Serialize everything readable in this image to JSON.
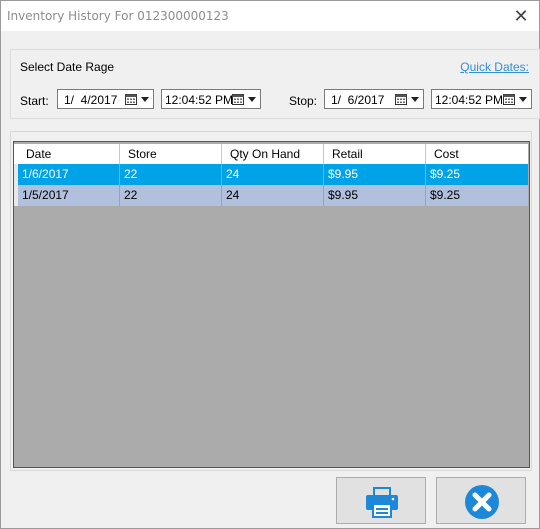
{
  "window": {
    "title": "Inventory History For 012300000123"
  },
  "filter": {
    "group_label": "Select Date Rage",
    "quick_dates": "Quick Dates:",
    "start_label": "Start:",
    "stop_label": "Stop:",
    "start_date": "1/  4/2017",
    "start_time": "12:04:52 PM",
    "stop_date": "1/  6/2017",
    "stop_time": "12:04:52 PM"
  },
  "table": {
    "columns": [
      "Date",
      "Store",
      "Qty On Hand",
      "Retail",
      "Cost"
    ],
    "rows": [
      [
        "1/6/2017",
        "22",
        "24",
        "$9.95",
        "$9.25"
      ],
      [
        "1/5/2017",
        "22",
        "24",
        "$9.95",
        "$9.25"
      ]
    ]
  },
  "colors": {
    "selected_row": "#00a2e8",
    "alt_row": "#b0c0dd",
    "grid_bg": "#ababab",
    "accent_blue": "#1e88d8"
  },
  "icons": {
    "print": "printer-icon",
    "close": "cancel-circle-icon"
  }
}
